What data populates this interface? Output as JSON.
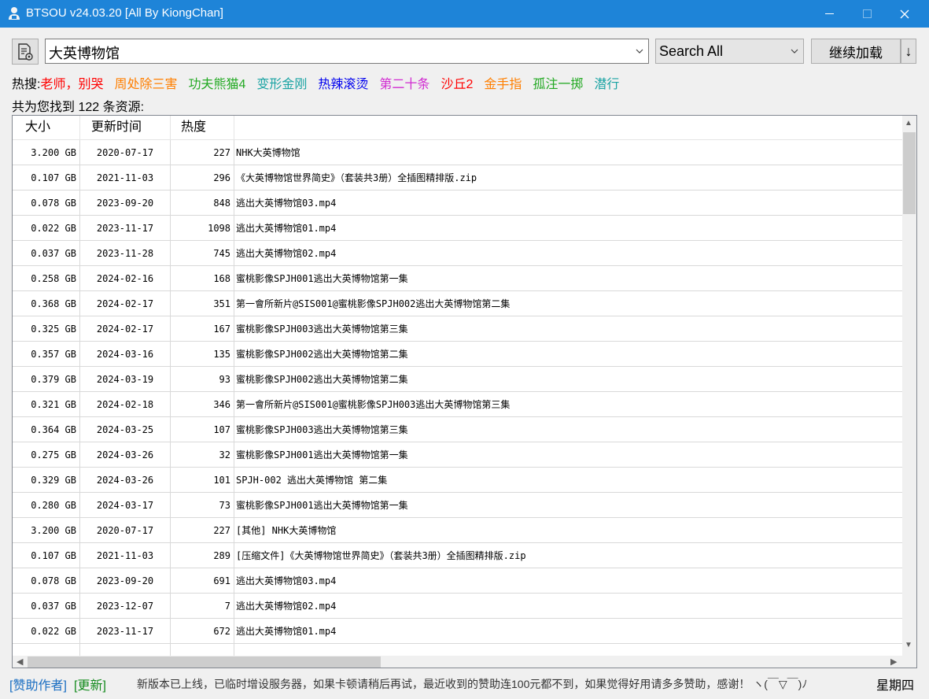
{
  "window": {
    "title": "BTSOU v24.03.20 [All By KiongChan]"
  },
  "toolbar": {
    "search_value": "大英博物馆",
    "scope_value": "Search All",
    "load_more_label": "继续加载",
    "sort_arrow": "↓"
  },
  "hot": {
    "label": "热搜:",
    "items": [
      {
        "text": "老师，别哭",
        "color": "#ff0000"
      },
      {
        "text": "周处除三害",
        "color": "#ff7f00"
      },
      {
        "text": "功夫熊猫4",
        "color": "#22a922"
      },
      {
        "text": "变形金刚",
        "color": "#1aa3a3"
      },
      {
        "text": "热辣滚烫",
        "color": "#0000ee"
      },
      {
        "text": "第二十条",
        "color": "#d12ad1"
      },
      {
        "text": "沙丘2",
        "color": "#ff0000"
      },
      {
        "text": "金手指",
        "color": "#ff7f00"
      },
      {
        "text": "孤注一掷",
        "color": "#22a922"
      },
      {
        "text": "潜行",
        "color": "#1aa3a3"
      }
    ]
  },
  "results": {
    "count_text": "共为您找到 122 条资源:",
    "headers": {
      "size": "大小",
      "date": "更新时间",
      "heat": "热度"
    },
    "rows": [
      {
        "size": "3.200 GB",
        "date": "2020-07-17",
        "heat": "227",
        "name": "NHK大英博物馆"
      },
      {
        "size": "0.107 GB",
        "date": "2021-11-03",
        "heat": "296",
        "name": "《大英博物馆世界简史》（套装共3册）全插图精排版.zip"
      },
      {
        "size": "0.078 GB",
        "date": "2023-09-20",
        "heat": "848",
        "name": "逃出大英博物馆03.mp4"
      },
      {
        "size": "0.022 GB",
        "date": "2023-11-17",
        "heat": "1098",
        "name": "逃出大英博物馆01.mp4"
      },
      {
        "size": "0.037 GB",
        "date": "2023-11-28",
        "heat": "745",
        "name": "逃出大英博物馆02.mp4"
      },
      {
        "size": "0.258 GB",
        "date": "2024-02-16",
        "heat": "168",
        "name": "蜜桃影像SPJH001逃出大英博物馆第一集"
      },
      {
        "size": "0.368 GB",
        "date": "2024-02-17",
        "heat": "351",
        "name": "第一會所新片@SIS001@蜜桃影像SPJH002逃出大英博物馆第二集"
      },
      {
        "size": "0.325 GB",
        "date": "2024-02-17",
        "heat": "167",
        "name": "蜜桃影像SPJH003逃出大英博物馆第三集"
      },
      {
        "size": "0.357 GB",
        "date": "2024-03-16",
        "heat": "135",
        "name": "蜜桃影像SPJH002逃出大英博物馆第二集"
      },
      {
        "size": "0.379 GB",
        "date": "2024-03-19",
        "heat": "93",
        "name": "蜜桃影像SPJH002逃出大英博物馆第二集"
      },
      {
        "size": "0.321 GB",
        "date": "2024-02-18",
        "heat": "346",
        "name": "第一會所新片@SIS001@蜜桃影像SPJH003逃出大英博物馆第三集"
      },
      {
        "size": "0.364 GB",
        "date": "2024-03-25",
        "heat": "107",
        "name": "蜜桃影像SPJH003逃出大英博物馆第三集"
      },
      {
        "size": "0.275 GB",
        "date": "2024-03-26",
        "heat": "32",
        "name": "蜜桃影像SPJH001逃出大英博物馆第一集"
      },
      {
        "size": "0.329 GB",
        "date": "2024-03-26",
        "heat": "101",
        "name": "SPJH-002 逃出大英博物馆 第二集"
      },
      {
        "size": "0.280 GB",
        "date": "2024-03-17",
        "heat": "73",
        "name": "蜜桃影像SPJH001逃出大英博物馆第一集"
      },
      {
        "size": "3.200 GB",
        "date": "2020-07-17",
        "heat": "227",
        "name": "[其他] NHK大英博物馆"
      },
      {
        "size": "0.107 GB",
        "date": "2021-11-03",
        "heat": "289",
        "name": "[压缩文件]《大英博物馆世界简史》（套装共3册）全插图精排版.zip"
      },
      {
        "size": "0.078 GB",
        "date": "2023-09-20",
        "heat": "691",
        "name": "逃出大英博物馆03.mp4"
      },
      {
        "size": "0.037 GB",
        "date": "2023-12-07",
        "heat": "7",
        "name": "逃出大英博物馆02.mp4"
      },
      {
        "size": "0.022 GB",
        "date": "2023-11-17",
        "heat": "672",
        "name": "逃出大英博物馆01.mp4"
      },
      {
        "size": "",
        "date": "",
        "heat": "",
        "name": ""
      }
    ]
  },
  "status": {
    "donate_link": "[赞助作者]",
    "update_link": "[更新]",
    "notice": "新版本已上线，已临时增设服务器，如果卡顿请稍后再试，最近收到的赞助连100元都不到，如果觉得好用请多多赞助，感谢！ ヽ(￣▽￣)ﾉ",
    "weekday": "星期四"
  },
  "icons": {
    "app": "user-download-icon",
    "tool": "document-settings-icon",
    "minimize": "minimize-icon",
    "maximize": "maximize-icon",
    "close": "close-icon"
  },
  "colors": {
    "titlebar": "#1e84d8",
    "donate": "#1a6ec2",
    "update": "#138a1d"
  }
}
